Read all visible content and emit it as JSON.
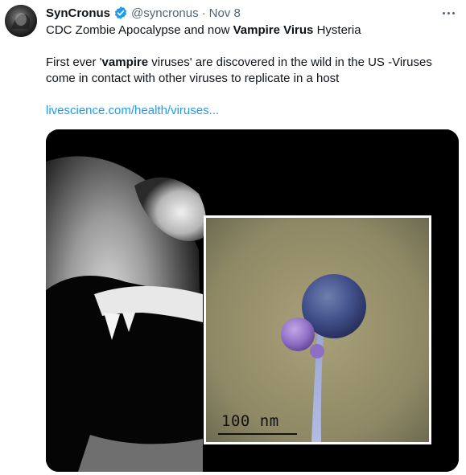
{
  "author": {
    "display_name": "SynCronus",
    "handle": "@syncronus",
    "separator": "·",
    "date": "Nov 8"
  },
  "icons": {
    "verified": "verified-badge-icon",
    "more": "more-options-icon"
  },
  "colors": {
    "link": "#1d9bf0",
    "verified": "#1d9bf0",
    "secondary_text": "#536471"
  },
  "tweet": {
    "line1_part1": "CDC Zombie Apocalypse and now ",
    "line1_bold": "Vampire Virus",
    "line1_part2": " Hysteria",
    "line2_part1": "First ever '",
    "line2_bold": "vampire",
    "line2_part2": " viruses' are discovered in the wild in the US -Viruses",
    "line3": "come in contact with other viruses to replicate in a host",
    "link": "livescience.com/health/viruses..."
  },
  "media": {
    "scale_label": "100 nm"
  }
}
